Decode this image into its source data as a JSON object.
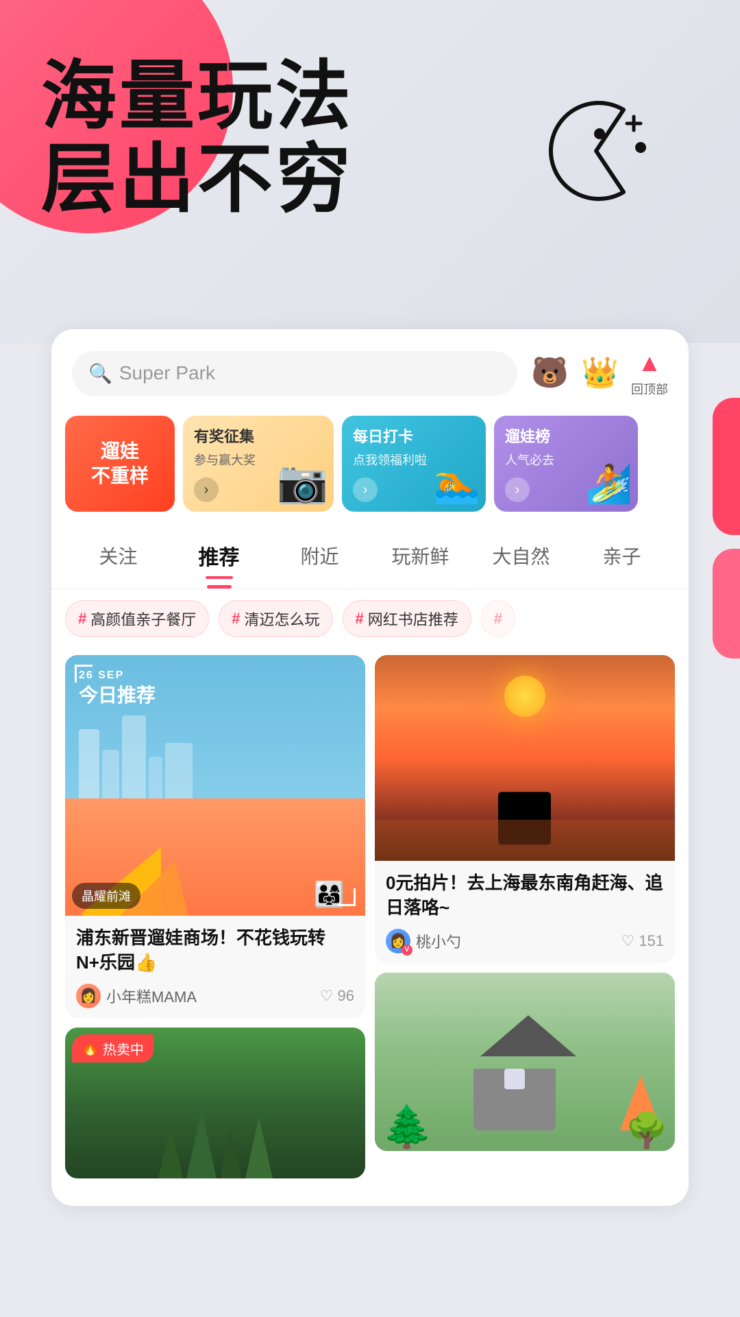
{
  "hero": {
    "title1": "海量玩法",
    "title2": "层出不穷"
  },
  "search": {
    "placeholder": "Super Park"
  },
  "header_icons": [
    {
      "emoji": "🐻",
      "label": "",
      "name": "bear-icon"
    },
    {
      "emoji": "👑",
      "label": "",
      "name": "crown-icon"
    },
    {
      "emoji": "🔺",
      "label": "回顶部",
      "name": "top-icon"
    }
  ],
  "banners": [
    {
      "id": 1,
      "text": "遛娃\n不重样",
      "type": "red"
    },
    {
      "id": 2,
      "title": "有奖征集",
      "desc": "参与赢大奖",
      "type": "yellow"
    },
    {
      "id": 3,
      "title": "每日打卡",
      "desc": "点我领福利啦",
      "type": "cyan"
    },
    {
      "id": 4,
      "title": "遛娃榜",
      "desc": "人气必去",
      "type": "purple"
    }
  ],
  "nav_tabs": [
    {
      "label": "关注",
      "active": false
    },
    {
      "label": "推荐",
      "active": true
    },
    {
      "label": "附近",
      "active": false
    },
    {
      "label": "玩新鲜",
      "active": false
    },
    {
      "label": "大自然",
      "active": false
    },
    {
      "label": "亲子",
      "active": false
    }
  ],
  "tags": [
    {
      "text": "高颜值亲子餐厅"
    },
    {
      "text": "清迈怎么玩"
    },
    {
      "text": "网红书店推荐"
    }
  ],
  "cards": [
    {
      "id": 1,
      "date": "26 SEP",
      "label": "今日推荐",
      "location": "晶耀前滩",
      "title": "浦东新晋遛娃商场！不花钱玩转N+乐园👍",
      "author": "小年糕MAMA",
      "likes": 96,
      "col": "left"
    },
    {
      "id": 2,
      "title": "0元拍片！去上海最东南角赶海、追日落咯~",
      "author": "桃小勺",
      "likes": 151,
      "col": "right"
    },
    {
      "id": 3,
      "hot_badge": "热卖中",
      "col": "left",
      "is_bottom": true
    },
    {
      "id": 4,
      "col": "right",
      "is_house": true
    }
  ],
  "ui": {
    "heart_icon": "♡",
    "fire_icon": "🔥",
    "hash_color": "#ff4466",
    "active_tab_color": "#111",
    "inactive_tab_color": "#666",
    "primary_color": "#ff4466"
  }
}
